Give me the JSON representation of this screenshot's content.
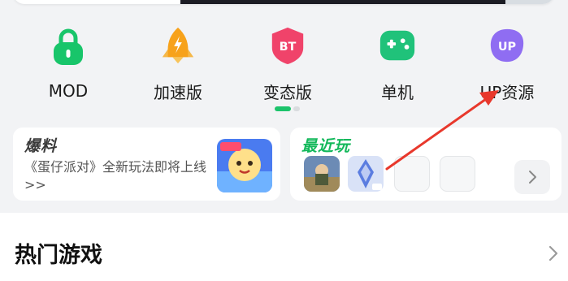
{
  "categories": [
    {
      "label": "MOD",
      "icon": "lock-icon",
      "color": "#18c56a"
    },
    {
      "label": "加速版",
      "icon": "rocket-icon",
      "color": "#f7a21b"
    },
    {
      "label": "变态版",
      "icon": "bt-badge-icon",
      "color": "#f0436a",
      "icon_text": "BT"
    },
    {
      "label": "单机",
      "icon": "gamepad-icon",
      "color": "#20c27a"
    },
    {
      "label": "UP资源",
      "icon": "up-badge-icon",
      "color": "#8f6df2",
      "icon_text": "UP"
    }
  ],
  "news": {
    "title": "爆料",
    "text": "《蛋仔派对》全新玩法即将上线>>"
  },
  "recent": {
    "title": "最近玩"
  },
  "hot": {
    "title": "热门游戏"
  },
  "colors": {
    "accent_green": "#1cc36b",
    "annotation_red": "#e8382c"
  }
}
